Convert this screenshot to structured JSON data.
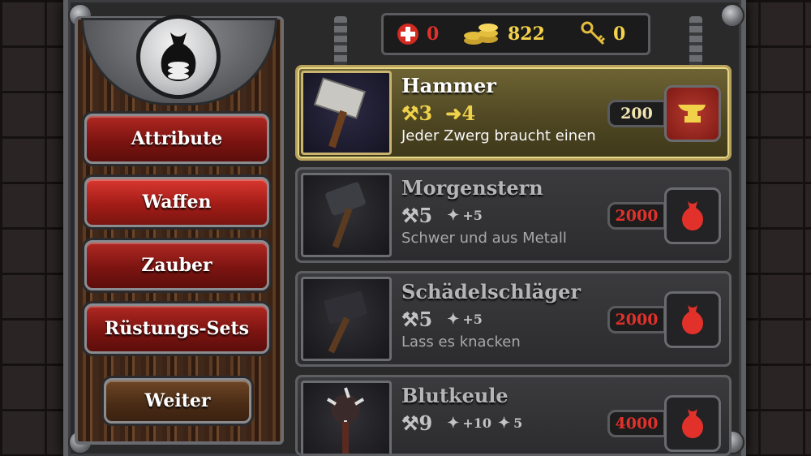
{
  "resources": {
    "health": "0",
    "gold": "822",
    "keys": "0"
  },
  "menu": {
    "items": [
      "Attribute",
      "Waffen",
      "Zauber",
      "Rüstungs-Sets"
    ],
    "active": "Waffen",
    "next_label": "Weiter"
  },
  "colors": {
    "selected_accent": "#e8d889",
    "price_red": "#e2312a",
    "stat_gold": "#f0d24a"
  },
  "items": [
    {
      "name": "Hammer",
      "attack": "3",
      "upgrade": "4",
      "description": "Jeder Zwerg braucht einen",
      "price": "200",
      "action_icon": "anvil-icon",
      "selected": true
    },
    {
      "name": "Morgenstern",
      "attack": "5",
      "bonus": "+5",
      "description": "Schwer und aus Metall",
      "price": "2000",
      "action_icon": "money-bag-icon"
    },
    {
      "name": "Schädelschläger",
      "attack": "5",
      "bonus": "+5",
      "description": "Lass es knacken",
      "price": "2000",
      "action_icon": "money-bag-icon"
    },
    {
      "name": "Blutkeule",
      "attack": "9",
      "bonus": "+10",
      "bonus2": "5",
      "description": "",
      "price": "4000",
      "action_icon": "money-bag-icon"
    }
  ]
}
